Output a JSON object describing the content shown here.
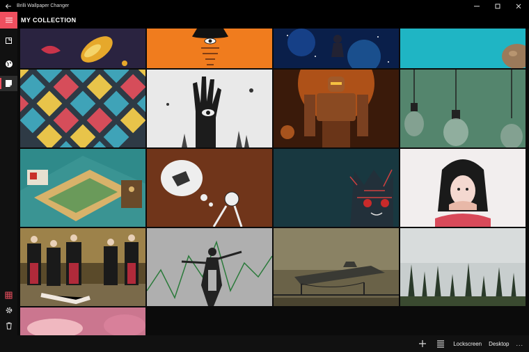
{
  "window": {
    "title": "Brilli Wallpaper Changer",
    "back_icon": "back-arrow-icon",
    "controls": [
      "minimize-icon",
      "maximize-icon",
      "close-icon"
    ]
  },
  "header": {
    "title": "MY COLLECTION"
  },
  "rail": {
    "top_items": [
      "hamburger-menu-icon",
      "new-tile-icon",
      "globe-icon",
      "collection-icon"
    ],
    "bottom_items": [
      "grid-icon",
      "gear-icon",
      "trash-icon"
    ],
    "accent_color": "#ef4f5f"
  },
  "collection": {
    "tiles": [
      "goldfish-bubbles",
      "bowler-hat-eye",
      "space-astronaut",
      "teal-sky-hamster",
      "floppy-disk-pattern",
      "hand-with-eye",
      "giant-robot",
      "hanging-lightbulbs",
      "money-mousetrap",
      "thought-bubble-wall",
      "cat-face-mural",
      "girl-hiding-face",
      "priests-and-dancer",
      "sound-of-music-stencil",
      "star-destroyer-bridge",
      "foggy-forest",
      "pink-clouds"
    ]
  },
  "command_bar": {
    "add_icon": "plus-icon",
    "list_icon": "list-icon",
    "lockscreen_label": "Lockscreen",
    "desktop_label": "Desktop",
    "more_label": "..."
  }
}
